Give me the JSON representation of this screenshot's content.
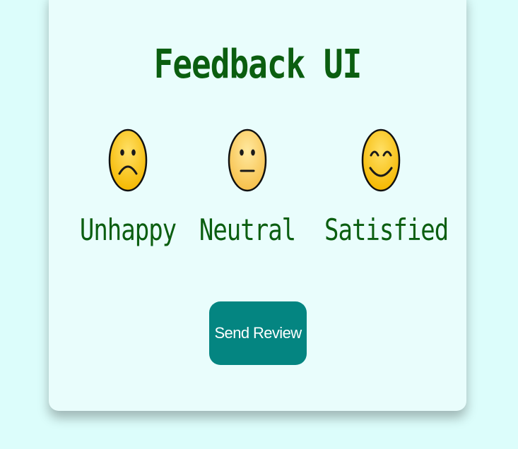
{
  "card": {
    "title": "Feedback UI"
  },
  "ratings": [
    {
      "label": "Unhappy",
      "icon": "sad-face-icon"
    },
    {
      "label": "Neutral",
      "icon": "neutral-face-icon"
    },
    {
      "label": "Satisfied",
      "icon": "smiling-face-icon"
    }
  ],
  "actions": {
    "send_label": "Send Review"
  },
  "colors": {
    "page_background": "#dcfdfb",
    "card_background": "#e9fdfc",
    "text": "#0b5e10",
    "button": "#048581",
    "button_text": "#ffffff",
    "face_fill": "#ffcc22"
  }
}
